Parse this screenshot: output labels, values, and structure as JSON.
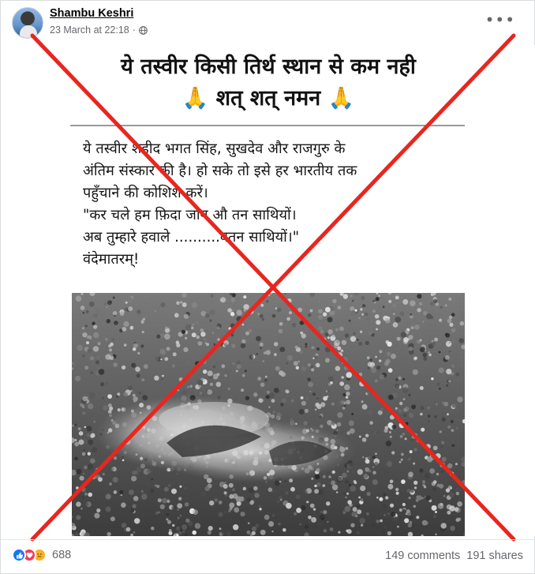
{
  "post": {
    "author": "Shambu Keshri",
    "timestamp": "23 March at 22:18",
    "separator": "·",
    "privacy_icon": "globe-icon",
    "more_icon": "more-options-icon"
  },
  "image": {
    "headline_line1": "ये तस्वीर किसी तिर्थ स्थान से कम नही",
    "headline_line2": "🙏 शत् शत् नमन 🙏",
    "caption_lines": [
      "ये तस्वीर शहीद भगत सिंह, सुखदेव और राजगुरु के",
      "अंतिम संस्कार की है। हो सके तो इसे हर भारतीय तक",
      "पहुँचाने की कोशिश करें।",
      "\"कर चले हम फ़िदा जान औ तन साथियों।",
      "अब तुम्हारे हवाले ..........वतन साथियों।\"",
      "वंदेमातरम्!"
    ],
    "overlay_color": "#e8261f"
  },
  "footer": {
    "reaction_icons": [
      "like-icon",
      "love-icon",
      "sad-icon"
    ],
    "reaction_count": "688",
    "comments": "149 comments",
    "shares": "191 shares"
  }
}
